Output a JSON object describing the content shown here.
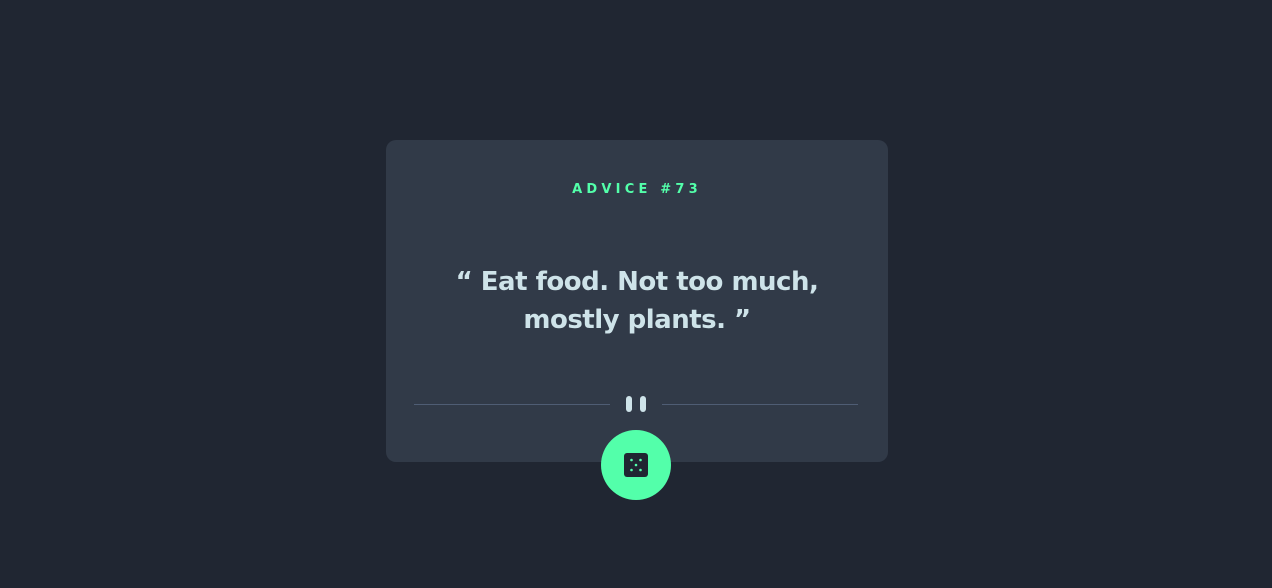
{
  "advice": {
    "label": "ADVICE #73",
    "quote": "“ Eat food. Not too much, mostly plants. ”"
  },
  "icons": {
    "divider": "pause-icon",
    "button": "dice-icon"
  },
  "colors": {
    "background": "#202632",
    "card": "#313a48",
    "accent": "#53ffaa",
    "text": "#cee3e9",
    "divider": "#4f5d74"
  }
}
